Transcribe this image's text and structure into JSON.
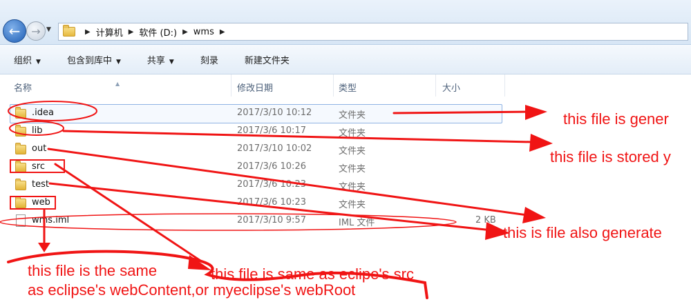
{
  "breadcrumb": {
    "items": [
      "计算机",
      "软件 (D:)",
      "wms"
    ]
  },
  "toolbar": {
    "organize": "组织",
    "include_in_library": "包含到库中",
    "share": "共享",
    "burn": "刻录",
    "new_folder": "新建文件夹"
  },
  "columns": {
    "name": "名称",
    "date_modified": "修改日期",
    "type": "类型",
    "size": "大小"
  },
  "files": [
    {
      "name": ".idea",
      "date": "2017/3/10 10:12",
      "type": "文件夹",
      "size": "",
      "icon": "folder-icon"
    },
    {
      "name": "lib",
      "date": "2017/3/6 10:17",
      "type": "文件夹",
      "size": "",
      "icon": "folder-icon"
    },
    {
      "name": "out",
      "date": "2017/3/10 10:02",
      "type": "文件夹",
      "size": "",
      "icon": "folder-icon"
    },
    {
      "name": "src",
      "date": "2017/3/6 10:26",
      "type": "文件夹",
      "size": "",
      "icon": "folder-icon"
    },
    {
      "name": "test",
      "date": "2017/3/6 10:23",
      "type": "文件夹",
      "size": "",
      "icon": "folder-icon"
    },
    {
      "name": "web",
      "date": "2017/3/6 10:23",
      "type": "文件夹",
      "size": "",
      "icon": "folder-icon"
    },
    {
      "name": "wms.iml",
      "date": "2017/3/10 9:57",
      "type": "IML 文件",
      "size": "2 KB",
      "icon": "document-icon"
    }
  ],
  "annotations": {
    "idea_note": "this file is gener",
    "lib_note": "this file is stored y",
    "iml_note": "this is file also generate",
    "web_note_line1": "this file is the same",
    "web_note_line2": "as eclipse's webContent,or myeclipse's webRoot",
    "src_note": "this file is same as eclipe's src"
  },
  "colors": {
    "annotation": "#f01414",
    "toolbar_bg": "#e3edf8",
    "selection_border": "#8db2e3"
  }
}
